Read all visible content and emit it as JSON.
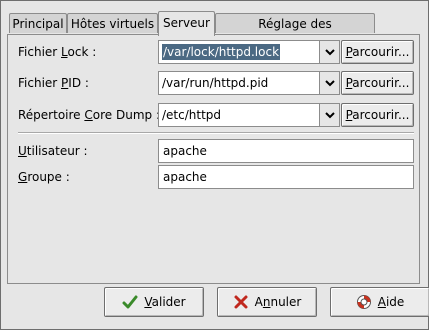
{
  "tabs": [
    {
      "label": "Principal",
      "active": false
    },
    {
      "label": "Hôtes virtuels",
      "active": false
    },
    {
      "label": "Serveur",
      "active": true
    },
    {
      "label": "Réglage des performances",
      "active": false
    }
  ],
  "server": {
    "lock_file": {
      "label_pre": "Fichier ",
      "label_key": "L",
      "label_post": "ock :",
      "value": "/var/lock/httpd.lock",
      "selected": true
    },
    "pid_file": {
      "label_pre": "Fichier ",
      "label_key": "P",
      "label_post": "ID :",
      "value": "/var/run/httpd.pid"
    },
    "core_dump": {
      "label_pre": "Répertoire ",
      "label_key": "C",
      "label_post": "ore Dump :",
      "value": "/etc/httpd"
    },
    "browse_key": "P",
    "browse_rest": "arcourir...",
    "user": {
      "label_key": "U",
      "label_post": "tilisateur :",
      "value": "apache"
    },
    "group": {
      "label_key": "G",
      "label_post": "roupe :",
      "value": "apache"
    }
  },
  "actions": {
    "ok": {
      "key": "V",
      "rest": "alider",
      "icon": "checkmark-icon"
    },
    "cancel": {
      "pre": "A",
      "key": "n",
      "rest": "nuler",
      "icon": "close-x-icon"
    },
    "help": {
      "key": "A",
      "rest": "ide",
      "icon": "lifebuoy-icon"
    }
  },
  "colors": {
    "selection": "#4b6983",
    "ok_icon": "#3a8a2a",
    "cancel_icon": "#c0281e",
    "help_icon": "#c8321e"
  }
}
